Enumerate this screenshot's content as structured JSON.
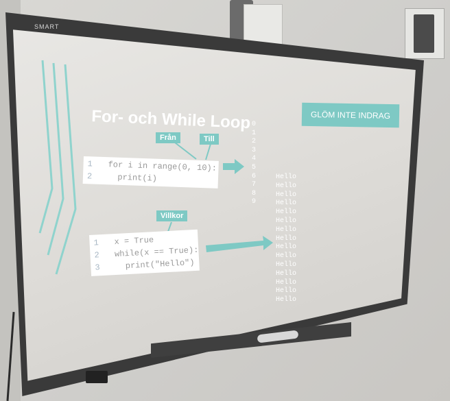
{
  "device": {
    "brand": "SMART"
  },
  "slide": {
    "title": "For- och While Loop",
    "banner": "GLÖM INTE INDRAG",
    "tags": {
      "from": "Från",
      "to": "Till",
      "condition": "Villkor"
    }
  },
  "code_for": [
    {
      "num": "1",
      "code": "for i in range(0, 10):"
    },
    {
      "num": "2",
      "code": "  print(i)"
    }
  ],
  "code_while": [
    {
      "num": "1",
      "code": "x = True"
    },
    {
      "num": "2",
      "code": "while(x == True):"
    },
    {
      "num": "3",
      "code": "  print(\"Hello\")"
    }
  ],
  "output_numbers": [
    "0",
    "1",
    "2",
    "3",
    "4",
    "5",
    "6",
    "7",
    "8",
    "9"
  ],
  "output_hello": [
    "Hello",
    "Hello",
    "Hello",
    "Hello",
    "Hello",
    "Hello",
    "Hello",
    "Hello",
    "Hello",
    "Hello",
    "Hello",
    "Hello",
    "Hello",
    "Hello",
    "Hello"
  ],
  "colors": {
    "accent": "#7ec9c4",
    "frame": "#3a3a3a",
    "text": "#ffffff"
  }
}
